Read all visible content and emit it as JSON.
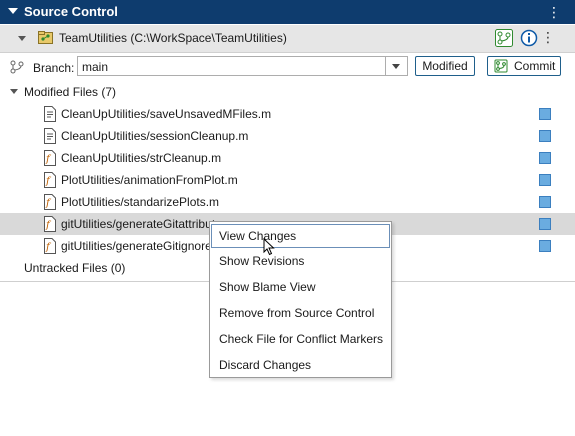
{
  "panel": {
    "title": "Source Control",
    "menu_icon": "kebab-icon"
  },
  "repo": {
    "label": "TeamUtilities (C:\\WorkSpace\\TeamUtilities)"
  },
  "branch": {
    "label": "Branch:",
    "value": "main",
    "modified_button": "Modified",
    "commit_button": "Commit"
  },
  "modified": {
    "header": "Modified Files (7)",
    "files": [
      {
        "name": "CleanUpUtilities/saveUnsavedMFiles.m",
        "icon": "mfile-icon"
      },
      {
        "name": "CleanUpUtilities/sessionCleanup.m",
        "icon": "mfile-icon"
      },
      {
        "name": "CleanUpUtilities/strCleanup.m",
        "icon": "function-file-icon"
      },
      {
        "name": "PlotUtilities/animationFromPlot.m",
        "icon": "function-file-icon"
      },
      {
        "name": "PlotUtilities/standarizePlots.m",
        "icon": "function-file-icon"
      },
      {
        "name": "gitUtilities/generateGitattributes.m",
        "icon": "function-file-icon"
      },
      {
        "name": "gitUtilities/generateGitignore.m",
        "icon": "function-file-icon"
      }
    ]
  },
  "untracked": {
    "header": "Untracked Files (0)"
  },
  "context_menu": {
    "items": [
      "View Changes",
      "Show Revisions",
      "Show Blame View",
      "Remove from Source Control",
      "Check File for Conflict Markers",
      "Discard Changes"
    ]
  },
  "colors": {
    "titlebar": "#0e3c6e",
    "status": "#6aace0",
    "selected_row": "#d9d9d9"
  }
}
